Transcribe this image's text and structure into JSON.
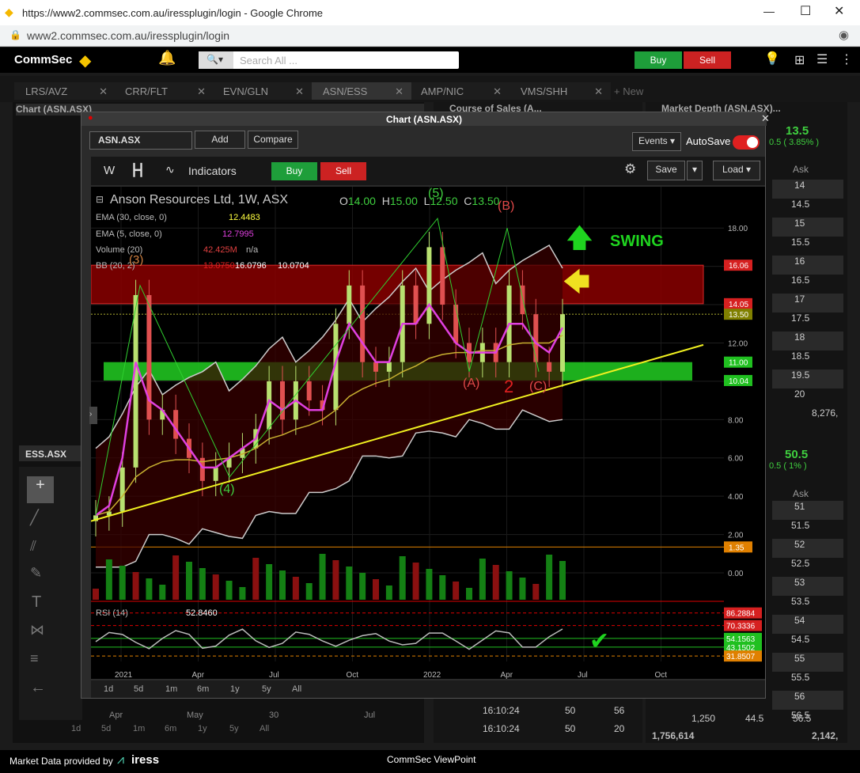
{
  "browser": {
    "url_title": "https://www2.commsec.com.au/iressplugin/login - Google Chrome",
    "address": "www2.commsec.com.au/iressplugin/login"
  },
  "app": {
    "logo": "CommSec",
    "search_placeholder": "Search All ...",
    "buy": "Buy",
    "sell": "Sell"
  },
  "tabs": [
    "LRS/AVZ",
    "CRR/FLT",
    "EVN/GLN",
    "ASN/ESS",
    "AMP/NIC",
    "VMS/SHH",
    "+ New"
  ],
  "bg_panels": {
    "chart_title": "Chart (ASN.ASX)",
    "course_of_sales": "Course of Sales (A...",
    "market_depth": "Market Depth (ASN.ASX)...",
    "ess_code": "ESS.ASX",
    "md1_price": "13.5",
    "md1_change": "0.5 ( 3.85% )",
    "md2_price": "50.5",
    "md2_change": "0.5 ( 1% )",
    "ask_header": "Ask",
    "ask1": [
      "14",
      "14.5",
      "15",
      "15.5",
      "16",
      "16.5",
      "17",
      "17.5",
      "18",
      "18.5",
      "19.5",
      "20"
    ],
    "ask1_total": "8,276,",
    "ask2": [
      "51",
      "51.5",
      "52",
      "52.5",
      "53",
      "53.5",
      "54",
      "54.5",
      "55",
      "55.5",
      "56",
      "56.5"
    ],
    "cos_rows": [
      {
        "time": "16:10:24",
        "vol": "50",
        "v": "56"
      },
      {
        "time": "16:10:24",
        "vol": "50",
        "v": "20"
      }
    ],
    "bottom_vals": [
      "1,250",
      "44.5",
      "56.5"
    ],
    "bottom_total": [
      "1,756,614",
      "2,142,"
    ],
    "bg_periods": [
      "1d",
      "5d",
      "1m",
      "6m",
      "1y",
      "5y",
      "All"
    ],
    "bg_months": [
      "Apr",
      "May",
      "30",
      "Jul"
    ]
  },
  "chart_window": {
    "title": "Chart (ASN.ASX)",
    "code": "ASN.ASX",
    "add": "Add",
    "compare": "Compare",
    "events": "Events",
    "autosave": "AutoSave",
    "interval": "W",
    "indicators": "Indicators",
    "buy": "Buy",
    "sell": "Sell",
    "save": "Save",
    "load": "Load"
  },
  "chart": {
    "security": "Anson Resources Ltd, 1W, ASX",
    "ohlc": {
      "o_label": "O",
      "o": "14.00",
      "h_label": "H",
      "h": "15.00",
      "l_label": "L",
      "l": "12.50",
      "c_label": "C",
      "c": "13.50"
    },
    "ema30": {
      "label": "EMA (30, close, 0)",
      "value": "12.4483"
    },
    "ema5": {
      "label": "EMA (5, close, 0)",
      "value": "12.7995"
    },
    "volume": {
      "label": "Volume (20)",
      "value": "42.425M",
      "ma": "n/a"
    },
    "bb": {
      "label": "BB (20, 2)",
      "v1": "13.0750",
      "v2": "16.0796",
      "v3": "10.0704"
    },
    "rsi": {
      "label": "RSI (14)",
      "value": "52.8460"
    },
    "y_ticks": [
      "18.00",
      "16.00",
      "14.00",
      "12.00",
      "10.00",
      "8.00",
      "6.00",
      "4.00",
      "2.00",
      "0.00"
    ],
    "price_labels": [
      {
        "v": "16.06",
        "c": "#d62020"
      },
      {
        "v": "14.05",
        "c": "#d62020"
      },
      {
        "v": "13.50",
        "c": "#808000"
      },
      {
        "v": "11.00",
        "c": "#20c020"
      },
      {
        "v": "10.04",
        "c": "#20c020"
      },
      {
        "v": "1.35",
        "c": "#e08000"
      }
    ],
    "rsi_labels": [
      {
        "v": "86.2884",
        "c": "#d62020"
      },
      {
        "v": "70.3336",
        "c": "#d62020"
      },
      {
        "v": "54.1563",
        "c": "#20c020"
      },
      {
        "v": "43.1502",
        "c": "#20c020"
      },
      {
        "v": "31.8507",
        "c": "#e08000"
      }
    ],
    "x_ticks": [
      "2021",
      "Apr",
      "Jul",
      "Oct",
      "2022",
      "Apr",
      "Jul",
      "Oct"
    ],
    "periods": [
      "1d",
      "5d",
      "1m",
      "6m",
      "1y",
      "5y",
      "All"
    ],
    "annotations": {
      "swing": "SWING",
      "w3": "(3)",
      "w4": "(4)",
      "w5": "(5)",
      "wa": "(A)",
      "wb": "(B)",
      "wc": "(C)",
      "two": "2"
    }
  },
  "footer": {
    "left": "Market Data provided by",
    "brand": "iress",
    "center": "CommSec ViewPoint"
  },
  "chart_data": {
    "type": "line",
    "title": "Anson Resources Ltd, 1W, ASX",
    "x": [
      "2021",
      "Apr",
      "Jul",
      "Oct",
      "2022",
      "Apr",
      "Jul",
      "Oct"
    ],
    "ylim": [
      0,
      19
    ],
    "series": [
      {
        "name": "Anson Resources Ltd, 1W, ASX",
        "values": [
          3,
          3.2,
          5.5,
          14.5,
          8,
          8.5,
          7,
          6,
          4.8,
          5.5,
          6,
          6.5,
          7.5,
          10,
          8,
          10,
          9,
          8.5,
          13,
          15,
          11,
          10.5,
          11,
          15,
          13,
          17,
          14,
          12,
          11,
          12,
          11,
          15,
          13.5,
          11,
          10.5,
          13.5
        ]
      },
      {
        "name": "EMA (5, close, 0)",
        "values": [
          3,
          3.5,
          6,
          11,
          9,
          8.5,
          7.5,
          6.5,
          5.5,
          5.5,
          6,
          6.5,
          7,
          9,
          8.5,
          9,
          8.5,
          8.5,
          11,
          13,
          12,
          11,
          11,
          13,
          13,
          14,
          13,
          12,
          11.5,
          11.5,
          11.5,
          13,
          13,
          12,
          11.5,
          12.8
        ]
      },
      {
        "name": "EMA (30, close, 0)",
        "values": [
          3,
          3.2,
          4,
          5,
          5.5,
          5.8,
          5.9,
          5.9,
          5.8,
          5.9,
          6,
          6.2,
          6.5,
          7,
          7.2,
          7.5,
          7.7,
          8,
          8.5,
          9.2,
          9.6,
          9.9,
          10.1,
          10.5,
          10.8,
          11.2,
          11.4,
          11.5,
          11.5,
          11.6,
          11.6,
          11.9,
          12,
          12,
          12,
          12.4
        ]
      }
    ]
  }
}
